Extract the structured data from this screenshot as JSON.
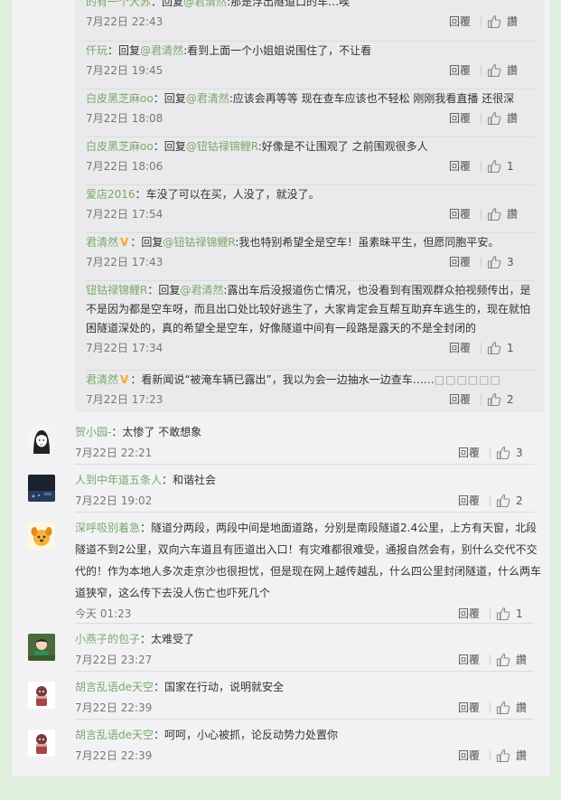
{
  "labels": {
    "reply": "回覆",
    "like": "讚"
  },
  "replies": [
    {
      "user": "的有一个大苏",
      "reply_to": "君清然",
      "text": "那是浮出隧道口的车…唉",
      "time": "7月22日 22:43",
      "likes": "讚"
    },
    {
      "user": "仟玩",
      "reply_to": "君清然",
      "text": "看到上面一个小姐姐说围住了，不让看",
      "time": "7月22日 19:45",
      "likes": "讚"
    },
    {
      "user": "白皮黑芝麻oo",
      "reply_to": "君清然",
      "text": "应该会再等等 现在查车应该也不轻松  刚刚我看直播 还很深",
      "time": "7月22日 18:08",
      "likes": "讚"
    },
    {
      "user": "白皮黑芝麻oo",
      "reply_to": "钮钴禄锦鲤R",
      "text": "好像是不让围观了 之前围观很多人",
      "time": "7月22日 18:06",
      "likes": "1"
    },
    {
      "user": "爱店2016",
      "reply_to": "",
      "text": "车没了可以在买，人没了，就没了。",
      "time": "7月22日 17:54",
      "likes": "讚"
    },
    {
      "user": "君清然",
      "verified": true,
      "reply_to": "钮钴禄锦鲤R",
      "text": "我也特别希望全是空车！虽素昧平生，但愿同胞平安。",
      "time": "7月22日 17:43",
      "likes": "3"
    },
    {
      "user": "钮钴禄锦鲤R",
      "reply_to": "君清然",
      "text": "露出车后没报道伤亡情况，也没看到有围观群众拍视频传出，是不是因为都是空车呀，而且出口处比较好逃生了，大家肯定会互帮互助弃车逃生的，现在就怕困隧道深处的，真的希望全是空车，好像隧道中间有一段路是露天的不是全封闭的",
      "time": "7月22日 17:34",
      "likes": "1"
    },
    {
      "user": "君清然",
      "verified": true,
      "reply_to": "",
      "text": "看新闻说“被淹车辆已露出”，我以为会一边抽水一边查车……",
      "tail": "□□□□□□",
      "time": "7月22日 17:23",
      "likes": "2"
    }
  ],
  "comments": [
    {
      "user": "贺小园-",
      "text": "太惨了 不敢想象",
      "time": "7月22日 22:21",
      "likes": "3",
      "avatar": "girl-sketch-avatar"
    },
    {
      "user": "人到中年道五条人",
      "text": "和谐社会",
      "time": "7月22日 19:02",
      "likes": "2",
      "avatar": "dark-photo-avatar"
    },
    {
      "user": "深呼吸别着急",
      "text": "隧道分两段，两段中间是地面道路，分别是南段隧道2.4公里，上方有天窗，北段隧道不到2公里，双向六车道且有匝道出入口！有灾难都很难受，通报自然会有，别什么交代不交代的！作为本地人多次走京沙也很担忧，但是现在网上越传越乱，什么四公里封闭隧道，什么两车道狭窄，这么传下去没人伤亡也吓死几个",
      "time": "今天 01:23",
      "likes": "1",
      "avatar": "cartoon-dog-avatar"
    },
    {
      "user": "小燕子的包子",
      "text": "太难受了",
      "time": "7月22日 23:27",
      "likes": "讚",
      "avatar": "green-figure-avatar"
    },
    {
      "user": "胡言乱语de天空",
      "text": "国家在行动，说明就安全",
      "time": "7月22日 22:39",
      "likes": "讚",
      "avatar": "toy-figure-avatar"
    },
    {
      "user": "胡言乱语de天空",
      "text": "呵呵，小心被抓，论反动势力处置你",
      "time": "7月22日 22:39",
      "likes": "讚",
      "avatar": "toy-figure-avatar"
    }
  ]
}
